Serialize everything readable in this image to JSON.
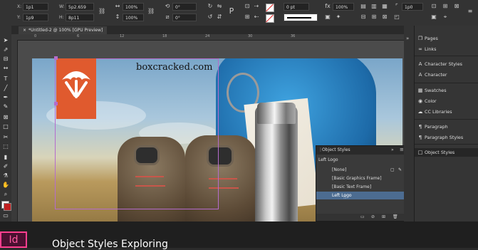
{
  "control_bar": {
    "x_label": "X:",
    "x_value": "1p1",
    "y_label": "Y:",
    "y_value": "1p9",
    "w_label": "W:",
    "w_value": "5p2.659",
    "h_label": "H:",
    "h_value": "8p11",
    "scale_x": "100%",
    "scale_y": "100%",
    "rotate": "0°",
    "shear": "0°",
    "stroke_weight": "0 pt",
    "opacity": "100%",
    "corner": "1p0"
  },
  "document": {
    "tab_label": "*Untitled-2 @ 100% [GPU Preview]",
    "close_glyph": "×",
    "ruler_ticks": [
      "0",
      "6",
      "12",
      "18",
      "24",
      "30",
      "36"
    ]
  },
  "canvas": {
    "watermark": "boxcracked.com"
  },
  "object_styles_panel": {
    "title": "Object Styles",
    "current": "Left Logo",
    "rows": [
      "[None]",
      "[Basic Graphics Frame]",
      "[Basic Text Frame]",
      "Left Logo"
    ],
    "selected_row": "Left Logo",
    "menu_glyph": "≡",
    "collapse_glyph": "»",
    "close_glyph": "×"
  },
  "dock": {
    "items": [
      {
        "icon": "pages-icon",
        "glyph": "❐",
        "label": "Pages"
      },
      {
        "icon": "links-icon",
        "glyph": "∞",
        "label": "Links"
      },
      {
        "icon": "character-styles-icon",
        "glyph": "A",
        "label": "Character Styles"
      },
      {
        "icon": "character-icon",
        "glyph": "A",
        "label": "Character"
      },
      {
        "icon": "swatches-icon",
        "glyph": "▦",
        "label": "Swatches"
      },
      {
        "icon": "color-icon",
        "glyph": "◉",
        "label": "Color"
      },
      {
        "icon": "cc-libraries-icon",
        "glyph": "☁",
        "label": "CC Libraries"
      },
      {
        "icon": "paragraph-icon",
        "glyph": "¶",
        "label": "Paragraph"
      },
      {
        "icon": "paragraph-styles-icon",
        "glyph": "¶",
        "label": "Paragraph Styles"
      },
      {
        "icon": "object-styles-icon",
        "glyph": "□",
        "label": "Object Styles"
      }
    ]
  },
  "bottom": {
    "app_logo": "Id",
    "caption": "Object Styles Exploring"
  },
  "colors": {
    "logo_orange": "#e05a2e",
    "frame_purple": "#b56ccc",
    "selection_blue": "#4c6c91",
    "indesign_pink": "#ff3f8f"
  }
}
